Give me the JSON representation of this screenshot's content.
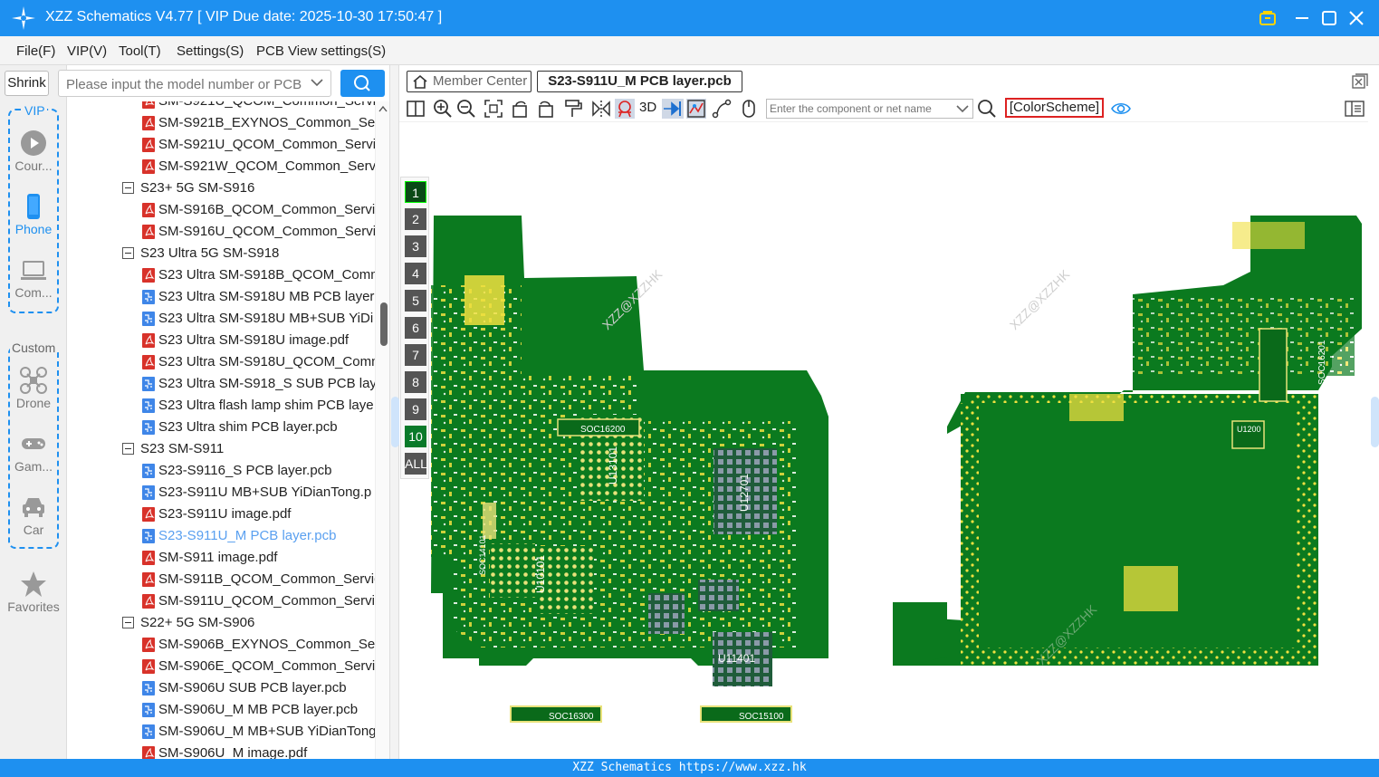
{
  "app": {
    "title": "XZZ Schematics V4.77 [ VIP Due date: 2025-10-30 17:50:47 ]"
  },
  "menu": [
    "File(F)",
    "VIP(V)",
    "Tool(T)",
    "Settings(S)",
    "PCB View settings(S)"
  ],
  "left": {
    "shrink": "Shrink",
    "vip_label": "VIP",
    "custom_label": "Custom",
    "items": [
      {
        "label": "Cour...",
        "icon": "play-icon"
      },
      {
        "label": "Phone",
        "icon": "phone-icon",
        "active": true
      },
      {
        "label": "Com...",
        "icon": "laptop-icon"
      },
      {
        "label": "Drone",
        "icon": "drone-icon"
      },
      {
        "label": "Gam...",
        "icon": "gamepad-icon"
      },
      {
        "label": "Car",
        "icon": "car-icon"
      },
      {
        "label": "Favorites",
        "icon": "star-icon"
      }
    ]
  },
  "search": {
    "placeholder": "Please input the model number or PCB"
  },
  "tree": [
    {
      "type": "pdf",
      "label": "SM-S921U_QCOM_Common_Servic"
    },
    {
      "type": "pdf",
      "label": "SM-S921B_EXYNOS_Common_Serv"
    },
    {
      "type": "pdf",
      "label": "SM-S921U_QCOM_Common_Servic"
    },
    {
      "type": "pdf",
      "label": "SM-S921W_QCOM_Common_Servi"
    },
    {
      "type": "folder",
      "label": "S23+ 5G SM-S916"
    },
    {
      "type": "pdf",
      "label": "SM-S916B_QCOM_Common_Servic"
    },
    {
      "type": "pdf",
      "label": "SM-S916U_QCOM_Common_Servic"
    },
    {
      "type": "folder",
      "label": "S23 Ultra 5G SM-S918"
    },
    {
      "type": "pdf",
      "label": "S23 Ultra SM-S918B_QCOM_Comm"
    },
    {
      "type": "pcb",
      "label": "S23 Ultra SM-S918U MB PCB layer."
    },
    {
      "type": "pcb",
      "label": "S23 Ultra SM-S918U MB+SUB YiDi"
    },
    {
      "type": "pdf",
      "label": "S23 Ultra SM-S918U image.pdf"
    },
    {
      "type": "pdf",
      "label": "S23 Ultra SM-S918U_QCOM_Comm"
    },
    {
      "type": "pcb",
      "label": "S23 Ultra SM-S918_S SUB PCB laye"
    },
    {
      "type": "pcb",
      "label": "S23 Ultra flash lamp shim PCB laye"
    },
    {
      "type": "pcb",
      "label": "S23 Ultra shim PCB layer.pcb"
    },
    {
      "type": "folder",
      "label": "S23 SM-S911"
    },
    {
      "type": "pcb",
      "label": "S23-S9116_S PCB layer.pcb"
    },
    {
      "type": "pcb",
      "label": "S23-S911U MB+SUB YiDianTong.p"
    },
    {
      "type": "pdf",
      "label": "S23-S911U image.pdf"
    },
    {
      "type": "pcb",
      "label": "S23-S911U_M PCB layer.pcb",
      "selected": true
    },
    {
      "type": "pdf",
      "label": "SM-S911 image.pdf"
    },
    {
      "type": "pdf",
      "label": "SM-S911B_QCOM_Common_Servic"
    },
    {
      "type": "pdf",
      "label": "SM-S911U_QCOM_Common_Servic"
    },
    {
      "type": "folder",
      "label": "S22+ 5G SM-S906"
    },
    {
      "type": "pdf",
      "label": "SM-S906B_EXYNOS_Common_Serv"
    },
    {
      "type": "pdf",
      "label": "SM-S906E_QCOM_Common_Servic"
    },
    {
      "type": "pcb",
      "label": "SM-S906U SUB PCB layer.pcb"
    },
    {
      "type": "pcb",
      "label": "SM-S906U_M MB PCB layer.pcb"
    },
    {
      "type": "pcb",
      "label": "SM-S906U_M MB+SUB YiDianTong"
    },
    {
      "type": "pdf",
      "label": "SM-S906U_M image.pdf"
    }
  ],
  "viewer": {
    "tabs": {
      "member": "Member Center",
      "active": "S23-S911U_M PCB layer.pcb"
    },
    "toolbar": {
      "3d_label": "3D",
      "net_placeholder": "Enter the component or net name",
      "colorscheme": "[ColorScheme]"
    },
    "layers": [
      "1",
      "2",
      "3",
      "4",
      "5",
      "6",
      "7",
      "8",
      "9",
      "10",
      "ALL"
    ],
    "labels": [
      "SOC16200",
      "U13101",
      "U12701",
      "SOC14101",
      "U10101",
      "U11401",
      "SOC16300",
      "SOC15100",
      "SOC16201",
      "U1200",
      "XZZ@XZZHK"
    ]
  },
  "status": "XZZ Schematics https://www.xzz.hk",
  "colors": {
    "accent": "#1e90f0",
    "pcb": "#0b7a1f",
    "copper": "#f0e040"
  }
}
